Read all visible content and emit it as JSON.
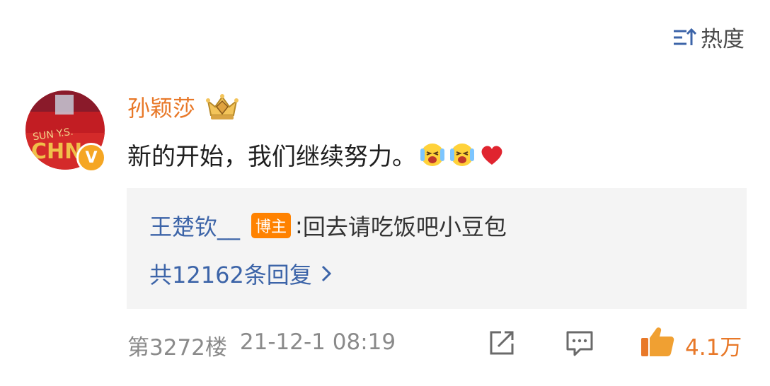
{
  "sort": {
    "label": "热度",
    "icon": "sort-icon"
  },
  "comment": {
    "username": "孙颖莎",
    "verified_badge": "V",
    "text": "新的开始，我们继续努力。",
    "emojis": [
      "crying-laughing-emoji",
      "crying-laughing-emoji",
      "red-heart-emoji"
    ]
  },
  "reply": {
    "user": "王楚钦__",
    "tag": "博主",
    "separator": ":",
    "text": "回去请吃饭吧小豆包",
    "count_label": "共12162条回复"
  },
  "footer": {
    "floor": "第3272楼",
    "timestamp": "21-12-1 08:19",
    "likes": "4.1万"
  },
  "colors": {
    "username": "#e87828",
    "link": "#3c64a8",
    "tag": "#ff8200",
    "like": "#e87828"
  }
}
